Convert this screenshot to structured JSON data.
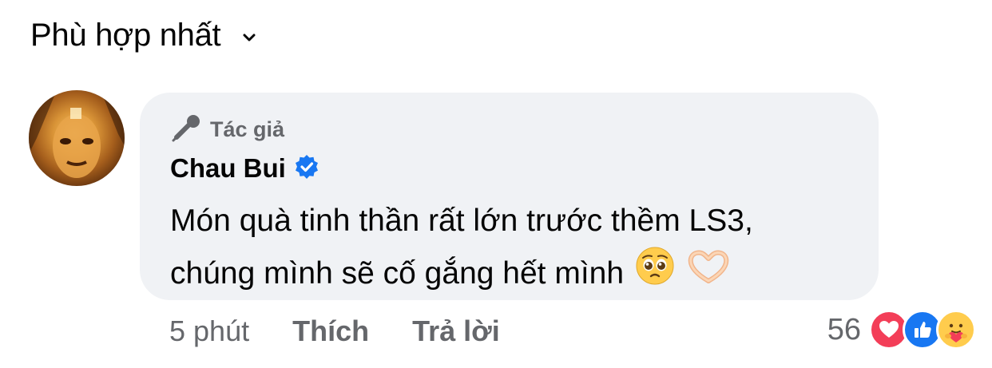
{
  "sort": {
    "label": "Phù hợp nhất"
  },
  "comment": {
    "author_tag": "Tác giả",
    "author_name": "Chau Bui",
    "text_line1": "Món quà tinh thần rất lớn trước thềm LS3,",
    "text_line2": "chúng mình sẽ cố gắng hết mình",
    "emojis": [
      "pleading-face",
      "heart-hands"
    ],
    "time": "5 phút",
    "like_label": "Thích",
    "reply_label": "Trả lời",
    "reaction_count": "56",
    "reactions": [
      "love",
      "like",
      "care"
    ]
  },
  "colors": {
    "accent_blue": "#1877f2",
    "love_red": "#f33e58",
    "muted_text": "#65676b",
    "bubble_bg": "#f0f2f5"
  }
}
